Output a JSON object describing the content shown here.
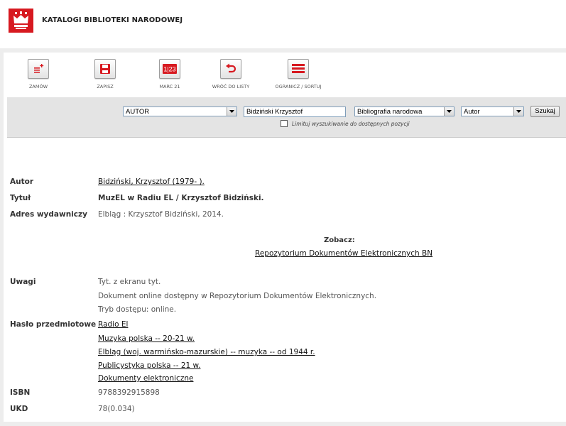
{
  "header": {
    "site_title": "KATALOGI BIBLIOTEKI NARODOWEJ"
  },
  "toolbar": {
    "buttons": [
      {
        "label": "ZAMÓW",
        "icon": "order-list-icon"
      },
      {
        "label": "ZAPISZ",
        "icon": "save-icon"
      },
      {
        "label": "MARC 21",
        "icon": "marc-icon",
        "icon_text": "1|23"
      },
      {
        "label": "WRÓĆ DO LISTY",
        "icon": "back-arrow-icon"
      },
      {
        "label": "OGRANICZ / SORTUJ",
        "icon": "list-icon"
      }
    ],
    "accent": "#d71920"
  },
  "search": {
    "field_select": "AUTOR",
    "query": "Bidziński Krzysztof",
    "base_select": "Bibliografia narodowa",
    "sort_select": "Autor",
    "button": "Szukaj",
    "checkbox_label": "Limituj wyszukiwanie do dostępnych pozycji"
  },
  "record": {
    "autor_label": "Autor",
    "autor_value": "Bidziński, Krzysztof (1979- ).",
    "tytul_label": "Tytuł",
    "tytul_value": "MuzEL w Radiu EL / Krzysztof Bidziński.",
    "adres_label": "Adres wydawniczy",
    "adres_value": "Elbląg : Krzysztof Bidziński, 2014.",
    "zobacz_label": "Zobacz:",
    "repo_link": "Repozytorium Dokumentów Elektronicznych BN",
    "uwagi_label": "Uwagi",
    "uwagi_values": [
      "Tyt. z ekranu tyt.",
      "Dokument online dostępny w Repozytorium Dokumentów Elektronicznych.",
      "Tryb dostępu: online."
    ],
    "haslo_label": "Hasło przedmiotowe",
    "haslo_values": [
      "Radio El",
      "Muzyka polska -- 20-21 w.",
      "Elbląg (woj. warmińsko-mazurskie) -- muzyka -- od 1944 r.",
      "Publicystyka polska -- 21 w.",
      "Dokumenty elektroniczne"
    ],
    "isbn_label": "ISBN",
    "isbn_value": "9788392915898",
    "ukd_label": "UKD",
    "ukd_value": "78(0.034)"
  }
}
